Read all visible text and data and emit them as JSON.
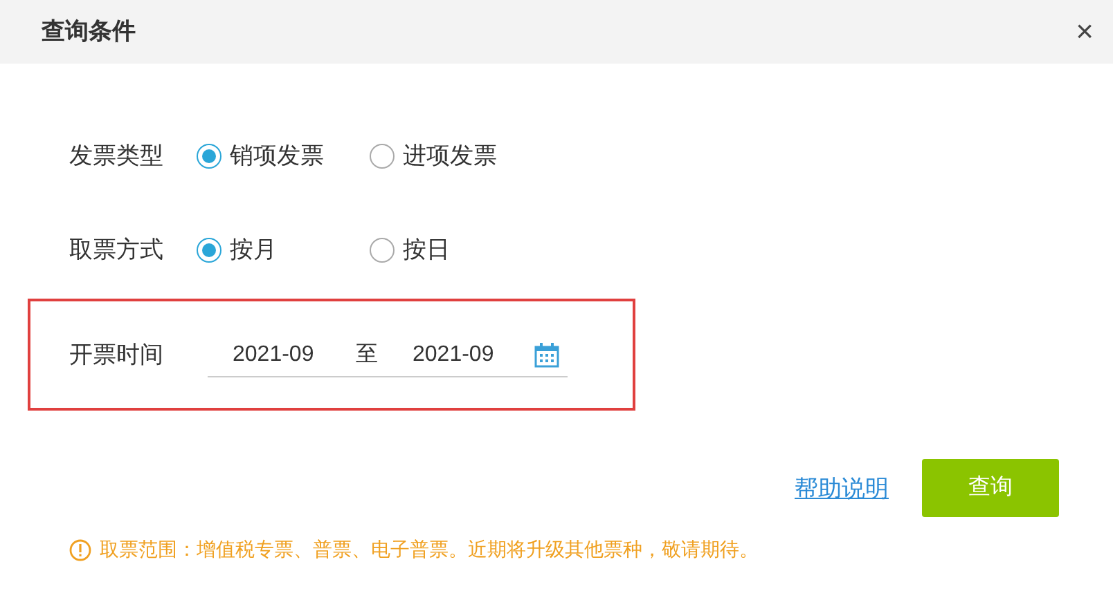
{
  "dialog": {
    "title": "查询条件",
    "close": "×"
  },
  "invoice_type": {
    "label": "发票类型",
    "options": [
      {
        "label": "销项发票",
        "selected": true
      },
      {
        "label": "进项发票",
        "selected": false
      }
    ]
  },
  "fetch_mode": {
    "label": "取票方式",
    "options": [
      {
        "label": "按月",
        "selected": true
      },
      {
        "label": "按日",
        "selected": false
      }
    ]
  },
  "date_range": {
    "label": "开票时间",
    "from": "2021-09",
    "separator": "至",
    "to": "2021-09"
  },
  "help_link": "帮助说明",
  "query_button": "查询",
  "notice": "取票范围：增值税专票、普票、电子普票。近期将升级其他票种，敬请期待。"
}
